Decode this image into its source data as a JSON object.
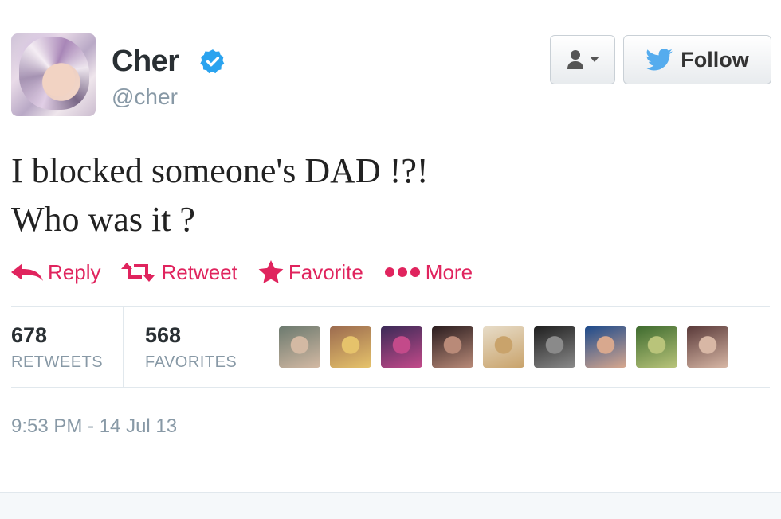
{
  "user": {
    "name": "Cher",
    "handle": "@cher",
    "verified": true
  },
  "buttons": {
    "follow_label": "Follow"
  },
  "tweet": {
    "lines": [
      "I blocked someone's DAD !?!",
      "Who was it ?"
    ]
  },
  "actions": {
    "reply": "Reply",
    "retweet": "Retweet",
    "favorite": "Favorite",
    "more": "More"
  },
  "stats": {
    "retweets_count": "678",
    "retweets_label": "RETWEETS",
    "favorites_count": "568",
    "favorites_label": "FAVORITES"
  },
  "favoriters": [
    {
      "name": "favoriter-avatar-1",
      "colors": [
        "#6c7a6f",
        "#d3b9a3"
      ]
    },
    {
      "name": "favoriter-avatar-2",
      "colors": [
        "#9c6b4f",
        "#e6c36b"
      ]
    },
    {
      "name": "favoriter-avatar-3",
      "colors": [
        "#3b2a57",
        "#c34a8a"
      ]
    },
    {
      "name": "favoriter-avatar-4",
      "colors": [
        "#2b1d1f",
        "#b98a78"
      ]
    },
    {
      "name": "favoriter-avatar-5",
      "colors": [
        "#e7dcc8",
        "#c9a36b"
      ]
    },
    {
      "name": "favoriter-avatar-6",
      "colors": [
        "#1f1f1f",
        "#8a8a8a"
      ]
    },
    {
      "name": "favoriter-avatar-7",
      "colors": [
        "#1d4a8c",
        "#d8a88e"
      ]
    },
    {
      "name": "favoriter-avatar-8",
      "colors": [
        "#3e6b2f",
        "#b9c47a"
      ]
    },
    {
      "name": "favoriter-avatar-9",
      "colors": [
        "#5a3a3a",
        "#d8b7a5"
      ]
    }
  ],
  "timestamp": "9:53 PM - 14 Jul 13",
  "colors": {
    "accent": "#e0245e",
    "twitter_blue": "#55acee",
    "verified_blue": "#2aa3ef",
    "muted": "#8899a6"
  }
}
